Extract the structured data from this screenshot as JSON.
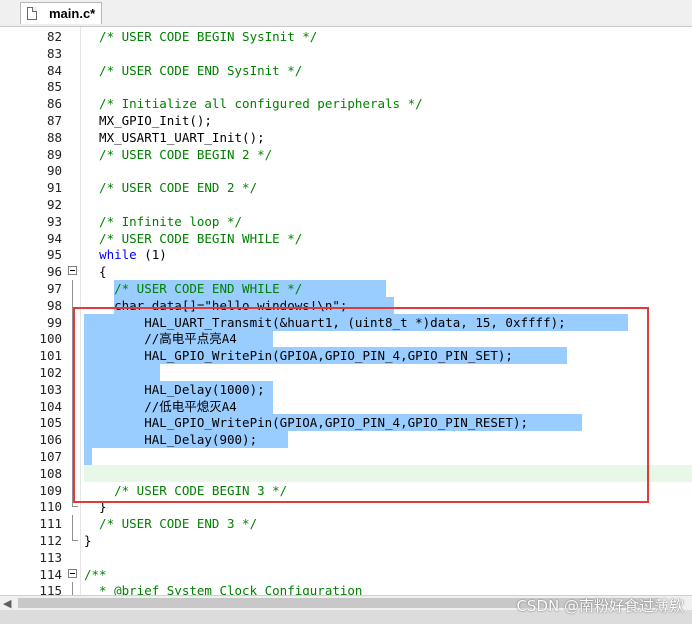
{
  "tab": {
    "label": "main.c*"
  },
  "lines": [
    {
      "n": "82",
      "code": "  /* USER CODE BEGIN SysInit */",
      "kind": "comment"
    },
    {
      "n": "83",
      "code": "",
      "kind": "plain"
    },
    {
      "n": "84",
      "code": "  /* USER CODE END SysInit */",
      "kind": "comment"
    },
    {
      "n": "85",
      "code": "",
      "kind": "plain"
    },
    {
      "n": "86",
      "code": "  /* Initialize all configured peripherals */",
      "kind": "comment"
    },
    {
      "n": "87",
      "code": "  MX_GPIO_Init();",
      "kind": "plain"
    },
    {
      "n": "88",
      "code": "  MX_USART1_UART_Init();",
      "kind": "plain"
    },
    {
      "n": "89",
      "code": "  /* USER CODE BEGIN 2 */",
      "kind": "comment"
    },
    {
      "n": "90",
      "code": "",
      "kind": "plain"
    },
    {
      "n": "91",
      "code": "  /* USER CODE END 2 */",
      "kind": "comment"
    },
    {
      "n": "92",
      "code": "",
      "kind": "plain"
    },
    {
      "n": "93",
      "code": "  /* Infinite loop */",
      "kind": "comment"
    },
    {
      "n": "94",
      "code": "  /* USER CODE BEGIN WHILE */",
      "kind": "comment"
    },
    {
      "n": "95",
      "code": "  while (1)",
      "kind": "while"
    },
    {
      "n": "96",
      "code": "  {",
      "kind": "plain"
    },
    {
      "n": "97",
      "code": "    /* USER CODE END WHILE */",
      "kind": "comment"
    },
    {
      "n": "98",
      "code": "    char data[]=\"hello windows!\\n\";",
      "kind": "plain"
    },
    {
      "n": "99",
      "code": "        HAL_UART_Transmit(&huart1, (uint8_t *)data, 15, 0xffff);",
      "kind": "plain"
    },
    {
      "n": "100",
      "code": "        //高电平点亮A4",
      "kind": "plain"
    },
    {
      "n": "101",
      "code": "        HAL_GPIO_WritePin(GPIOA,GPIO_PIN_4,GPIO_PIN_SET);",
      "kind": "plain"
    },
    {
      "n": "102",
      "code": "",
      "kind": "plain"
    },
    {
      "n": "103",
      "code": "        HAL_Delay(1000);",
      "kind": "plain"
    },
    {
      "n": "104",
      "code": "        //低电平熄灭A4",
      "kind": "plain"
    },
    {
      "n": "105",
      "code": "        HAL_GPIO_WritePin(GPIOA,GPIO_PIN_4,GPIO_PIN_RESET);",
      "kind": "plain"
    },
    {
      "n": "106",
      "code": "        HAL_Delay(900);",
      "kind": "plain"
    },
    {
      "n": "107",
      "code": "",
      "kind": "plain"
    },
    {
      "n": "108",
      "code": "",
      "kind": "plain"
    },
    {
      "n": "109",
      "code": "    /* USER CODE BEGIN 3 */",
      "kind": "comment"
    },
    {
      "n": "110",
      "code": "  }",
      "kind": "plain"
    },
    {
      "n": "111",
      "code": "  /* USER CODE END 3 */",
      "kind": "comment"
    },
    {
      "n": "112",
      "code": "}",
      "kind": "plain"
    },
    {
      "n": "113",
      "code": "",
      "kind": "plain"
    },
    {
      "n": "114",
      "code": "/**",
      "kind": "comment"
    },
    {
      "n": "115",
      "code": "  * @brief System Clock Configuration",
      "kind": "comment"
    }
  ],
  "watermark": "CSDN @南粉好食过薄欸",
  "colors": {
    "selection": "#99ccff",
    "highlight_box": "#e03a3a",
    "comment": "#008000",
    "keyword": "#0000ff"
  }
}
